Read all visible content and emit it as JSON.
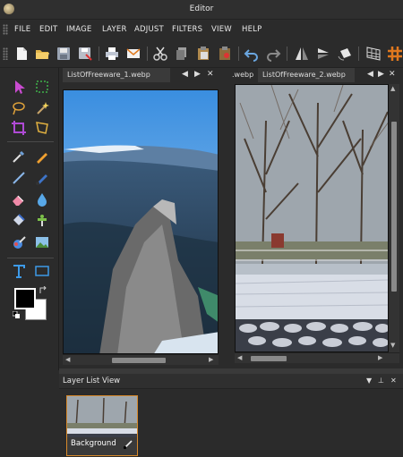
{
  "window": {
    "title": "Editor"
  },
  "menu": [
    "FILE",
    "EDIT",
    "IMAGE",
    "LAYER",
    "ADJUST",
    "FILTERS",
    "VIEW",
    "HELP"
  ],
  "documents": [
    {
      "tab_label": "ListOfFreeware_1.webp"
    },
    {
      "tab_label_prev": ".webp",
      "tab_label": "ListOfFreeware_2.webp"
    }
  ],
  "tab_controls": {
    "prev": "◀",
    "next": "▶",
    "close": "✕"
  },
  "layer_panel": {
    "title": "Layer List View",
    "controls": {
      "menu": "▼",
      "pin": "📌",
      "close": "✕"
    },
    "layer_name": "Background"
  },
  "colors": {
    "accent": "#d7892a",
    "foreground": "#000000",
    "background": "#ffffff"
  }
}
